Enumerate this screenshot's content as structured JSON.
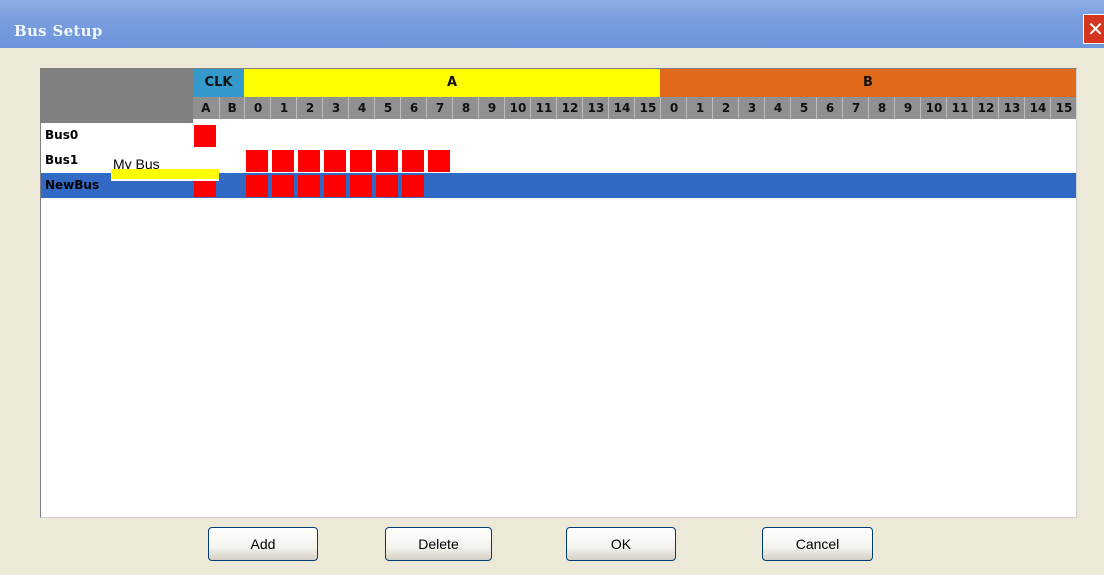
{
  "window": {
    "title": "Bus Setup",
    "close_label": "✕"
  },
  "header": {
    "groups": [
      {
        "label": "CLK",
        "color": "#3399cc"
      },
      {
        "label": "A",
        "color": "#ffff00"
      },
      {
        "label": "B",
        "color": "#e06a1a"
      }
    ],
    "clk_subs": [
      "A",
      "B"
    ],
    "a_subs": [
      "0",
      "1",
      "2",
      "3",
      "4",
      "5",
      "6",
      "7",
      "8",
      "9",
      "10",
      "11",
      "12",
      "13",
      "14",
      "15"
    ],
    "b_subs": [
      "0",
      "1",
      "2",
      "3",
      "4",
      "5",
      "6",
      "7",
      "8",
      "9",
      "10",
      "11",
      "12",
      "13",
      "14",
      "15"
    ]
  },
  "rows": [
    {
      "name": "Bus0",
      "assigned": [
        "CLK:A"
      ]
    },
    {
      "name": "Bus1",
      "assigned": [
        "A:0",
        "A:1",
        "A:2",
        "A:3",
        "A:4",
        "A:5",
        "A:6",
        "A:7"
      ]
    },
    {
      "name": "NewBus",
      "assigned": [
        "CLK:A",
        "A:0",
        "A:1",
        "A:2",
        "A:3",
        "A:4",
        "A:5",
        "A:6"
      ],
      "selected": true,
      "selection_color": "#316ac5"
    }
  ],
  "editor": {
    "value": "My Bus"
  },
  "buttons": {
    "add": "Add",
    "delete": "Delete",
    "ok": "OK",
    "cancel": "Cancel"
  }
}
